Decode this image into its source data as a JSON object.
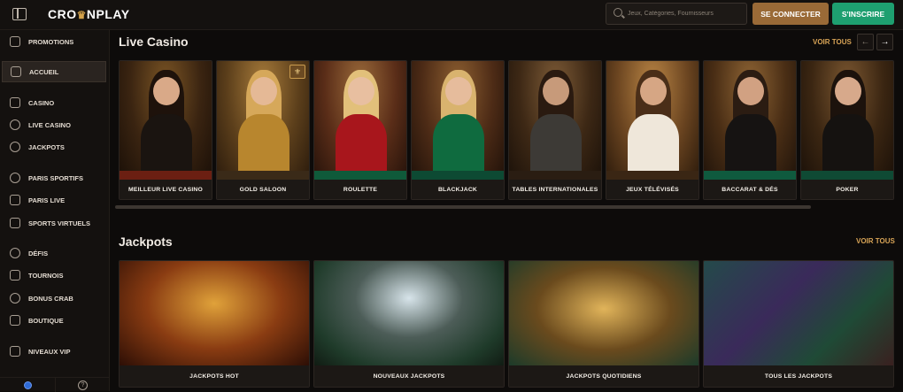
{
  "header": {
    "logo_text": "CRO",
    "logo_text_end": "NPLAY",
    "search_placeholder": "Jeux, Catégories, Fournisseurs",
    "login_label": "SE CONNECTER",
    "signup_label": "S'INSCRIRE",
    "colors": {
      "accent": "#d7a356",
      "login": "#9a6a37",
      "signup": "#1e9f70"
    }
  },
  "sidebar": {
    "items": [
      {
        "label": "PROMOTIONS",
        "icon": "gift-icon"
      },
      {
        "label": "ACCUEIL",
        "icon": "home-icon",
        "active": true
      },
      {
        "label": "CASINO",
        "icon": "slot-machine-icon"
      },
      {
        "label": "LIVE CASINO",
        "icon": "spade-icon"
      },
      {
        "label": "JACKPOTS",
        "icon": "coins-icon"
      },
      {
        "label": "PARIS SPORTIFS",
        "icon": "soccer-ball-icon"
      },
      {
        "label": "PARIS LIVE",
        "icon": "live-ticket-icon"
      },
      {
        "label": "SPORTS VIRTUELS",
        "icon": "virtual-sports-icon"
      },
      {
        "label": "DÉFIS",
        "icon": "challenge-icon"
      },
      {
        "label": "TOURNOIS",
        "icon": "trophy-icon"
      },
      {
        "label": "BONUS CRAB",
        "icon": "crab-icon"
      },
      {
        "label": "BOUTIQUE",
        "icon": "shop-icon"
      },
      {
        "label": "NIVEAUX VIP",
        "icon": "vip-crown-icon"
      }
    ],
    "footer": {
      "help_glyph": "?"
    }
  },
  "live_casino": {
    "title": "Live Casino",
    "see_all": "VOIR TOUS",
    "prev_glyph": "←",
    "next_glyph": "→",
    "cards": [
      {
        "label": "MEILLEUR LIVE CASINO"
      },
      {
        "label": "GOLD SALOON"
      },
      {
        "label": "ROULETTE"
      },
      {
        "label": "BLACKJACK"
      },
      {
        "label": "TABLES INTERNATIONALES"
      },
      {
        "label": "JEUX TÉLÉVISÉS"
      },
      {
        "label": "BACCARAT & DÉS"
      },
      {
        "label": "POKER"
      }
    ]
  },
  "jackpots": {
    "title": "Jackpots",
    "see_all": "VOIR TOUS",
    "cards": [
      {
        "label": "JACKPOTS HOT"
      },
      {
        "label": "NOUVEAUX JACKPOTS"
      },
      {
        "label": "JACKPOTS QUOTIDIENS"
      },
      {
        "label": "TOUS LES JACKPOTS"
      }
    ]
  }
}
